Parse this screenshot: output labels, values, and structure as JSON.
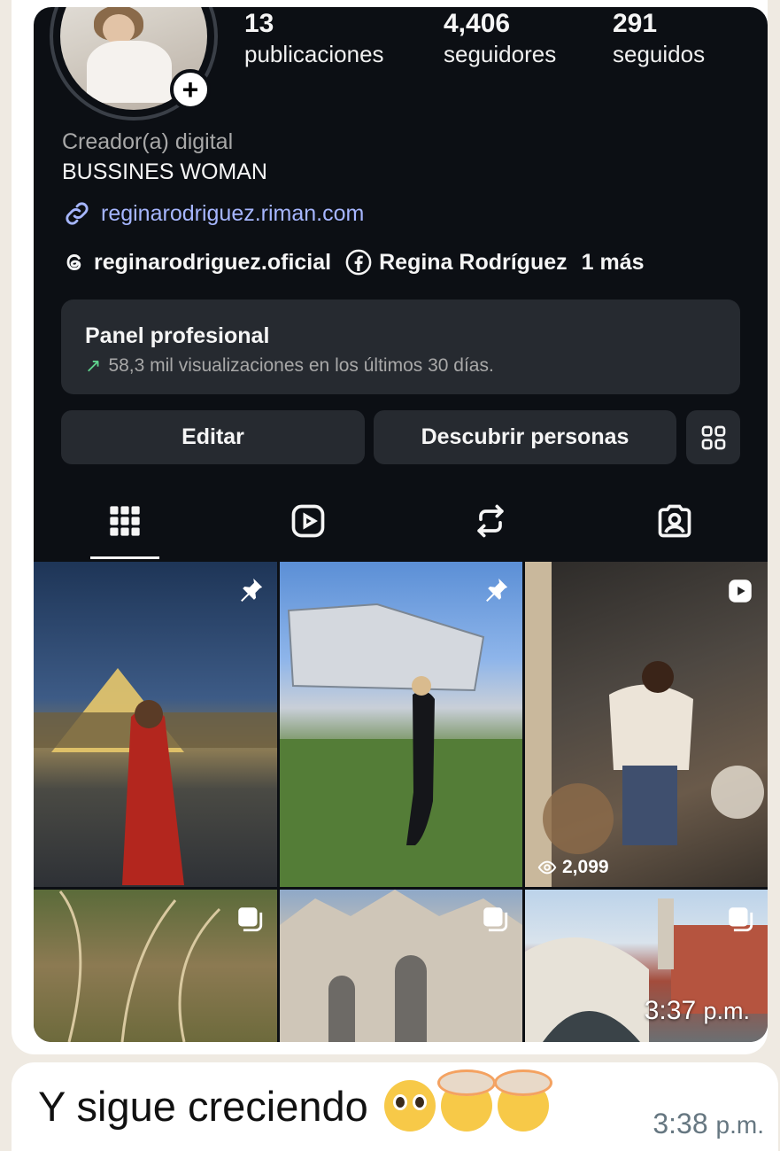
{
  "profile": {
    "stats": [
      {
        "num": "13",
        "label": "publicaciones"
      },
      {
        "num": "4,406",
        "label": "seguidores"
      },
      {
        "num": "291",
        "label": "seguidos"
      }
    ],
    "category": "Creador(a) digital",
    "bio": "BUSSINES WOMAN",
    "link": "reginarodriguez.riman.com",
    "threads": "reginarodriguez.oficial",
    "facebook": "Regina Rodríguez",
    "more": "1 más"
  },
  "panel": {
    "title": "Panel profesional",
    "subtitle": "58,3 mil visualizaciones en los últimos 30 días."
  },
  "buttons": {
    "edit": "Editar",
    "discover": "Descubrir personas"
  },
  "tabs": [
    "grid-icon",
    "reels-icon",
    "reposts-icon",
    "tagged-icon"
  ],
  "grid": {
    "reel_views": "2,099"
  },
  "message1": {
    "time": "3:37",
    "suffix": "p.m."
  },
  "message2": {
    "text": "Y sigue creciendo",
    "emojis": [
      "pleading-face",
      "exploding-head",
      "exploding-head"
    ],
    "time": "3:38",
    "suffix": "p.m."
  },
  "colors": {
    "chat_bg": "#efeae2",
    "ig_bg": "#0c0f14",
    "link": "#a6b6ff",
    "growth_arrow": "#5fd38d"
  }
}
